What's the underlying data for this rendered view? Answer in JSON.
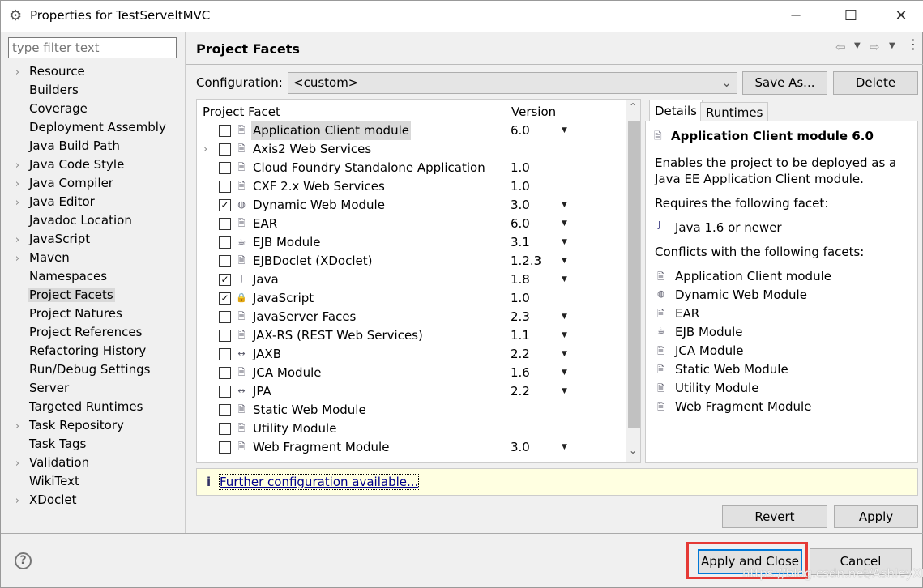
{
  "window": {
    "title": "Properties for TestServeltMVC",
    "minimize": "─",
    "maximize": "☐",
    "close": "✕"
  },
  "filter": {
    "placeholder": "type filter text"
  },
  "nav": [
    {
      "label": "Resource",
      "expandable": true
    },
    {
      "label": "Builders"
    },
    {
      "label": "Coverage"
    },
    {
      "label": "Deployment Assembly"
    },
    {
      "label": "Java Build Path"
    },
    {
      "label": "Java Code Style",
      "expandable": true
    },
    {
      "label": "Java Compiler",
      "expandable": true
    },
    {
      "label": "Java Editor",
      "expandable": true
    },
    {
      "label": "Javadoc Location"
    },
    {
      "label": "JavaScript",
      "expandable": true
    },
    {
      "label": "Maven",
      "expandable": true
    },
    {
      "label": "Namespaces"
    },
    {
      "label": "Project Facets",
      "selected": true
    },
    {
      "label": "Project Natures"
    },
    {
      "label": "Project References"
    },
    {
      "label": "Refactoring History"
    },
    {
      "label": "Run/Debug Settings"
    },
    {
      "label": "Server"
    },
    {
      "label": "Targeted Runtimes"
    },
    {
      "label": "Task Repository",
      "expandable": true
    },
    {
      "label": "Task Tags"
    },
    {
      "label": "Validation",
      "expandable": true
    },
    {
      "label": "WikiText"
    },
    {
      "label": "XDoclet",
      "expandable": true
    }
  ],
  "page": {
    "title": "Project Facets",
    "back": "⇦",
    "forward": "⇨"
  },
  "config": {
    "label": "Configuration:",
    "value": "<custom>",
    "save_as": "Save As...",
    "delete": "Delete"
  },
  "table": {
    "col_facet": "Project Facet",
    "col_version": "Version",
    "rows": [
      {
        "name": "Application Client module",
        "version": "6.0",
        "checked": false,
        "dd": true,
        "icon": "doc",
        "selected": true
      },
      {
        "name": "Axis2 Web Services",
        "version": "",
        "checked": false,
        "dd": false,
        "icon": "doc",
        "expandable": true
      },
      {
        "name": "Cloud Foundry Standalone Application",
        "version": "1.0",
        "checked": false,
        "dd": false,
        "icon": "doc"
      },
      {
        "name": "CXF 2.x Web Services",
        "version": "1.0",
        "checked": false,
        "dd": false,
        "icon": "doc"
      },
      {
        "name": "Dynamic Web Module",
        "version": "3.0",
        "checked": true,
        "dd": true,
        "icon": "globe"
      },
      {
        "name": "EAR",
        "version": "6.0",
        "checked": false,
        "dd": true,
        "icon": "doc"
      },
      {
        "name": "EJB Module",
        "version": "3.1",
        "checked": false,
        "dd": true,
        "icon": "bean"
      },
      {
        "name": "EJBDoclet (XDoclet)",
        "version": "1.2.3",
        "checked": false,
        "dd": true,
        "icon": "doc"
      },
      {
        "name": "Java",
        "version": "1.8",
        "checked": true,
        "dd": true,
        "icon": "java"
      },
      {
        "name": "JavaScript",
        "version": "1.0",
        "checked": true,
        "dd": false,
        "icon": "js"
      },
      {
        "name": "JavaServer Faces",
        "version": "2.3",
        "checked": false,
        "dd": true,
        "icon": "doc"
      },
      {
        "name": "JAX-RS (REST Web Services)",
        "version": "1.1",
        "checked": false,
        "dd": true,
        "icon": "doc"
      },
      {
        "name": "JAXB",
        "version": "2.2",
        "checked": false,
        "dd": true,
        "icon": "arrows"
      },
      {
        "name": "JCA Module",
        "version": "1.6",
        "checked": false,
        "dd": true,
        "icon": "doc"
      },
      {
        "name": "JPA",
        "version": "2.2",
        "checked": false,
        "dd": true,
        "icon": "arrows"
      },
      {
        "name": "Static Web Module",
        "version": "",
        "checked": false,
        "dd": false,
        "icon": "doc"
      },
      {
        "name": "Utility Module",
        "version": "",
        "checked": false,
        "dd": false,
        "icon": "doc"
      },
      {
        "name": "Web Fragment Module",
        "version": "3.0",
        "checked": false,
        "dd": true,
        "icon": "doc"
      }
    ]
  },
  "details": {
    "tab_details": "Details",
    "tab_runtimes": "Runtimes",
    "heading": "Application Client module 6.0",
    "desc1": "Enables the project to be deployed as a",
    "desc2": "Java EE Application Client module.",
    "requires_label": "Requires the following facet:",
    "requires": "Java 1.6 or newer",
    "conflicts_label": "Conflicts with the following facets:",
    "conflicts": [
      "Application Client module",
      "Dynamic Web Module",
      "EAR",
      "EJB Module",
      "JCA Module",
      "Static Web Module",
      "Utility Module",
      "Web Fragment Module"
    ]
  },
  "info": {
    "icon": "info-icon",
    "link": "Further configuration available..."
  },
  "buttons": {
    "revert": "Revert",
    "apply": "Apply",
    "apply_close": "Apply and Close",
    "cancel": "Cancel",
    "help": "?"
  },
  "watermark": "https://blog.csdn.net/AshleyXM",
  "colors": {
    "highlight": "#e53935",
    "link": "#00008b",
    "info_bg": "#ffffe1",
    "focus": "#0078d7"
  }
}
